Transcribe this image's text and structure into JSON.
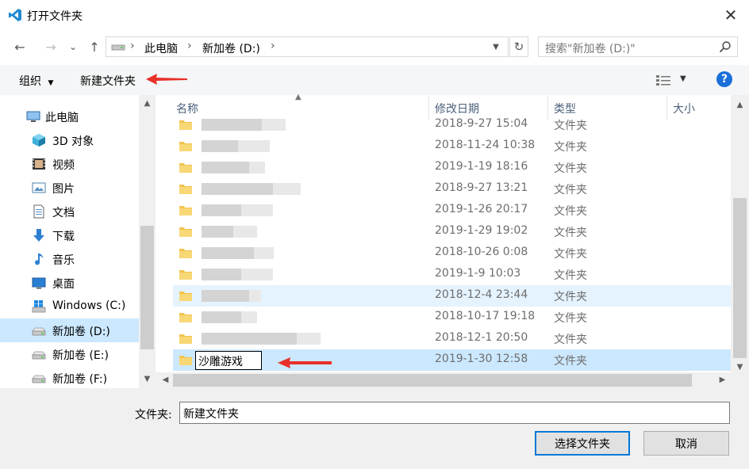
{
  "window": {
    "title": "打开文件夹",
    "close_glyph": "✕"
  },
  "nav": {
    "back_glyph": "←",
    "forward_glyph": "→",
    "recent_glyph": "⌄",
    "up_glyph": "↑",
    "breadcrumb": [
      "此电脑",
      "新加卷 (D:)"
    ],
    "refresh_glyph": "↻",
    "search_placeholder": "搜索\"新加卷 (D:)\""
  },
  "toolbar": {
    "organize": "组织",
    "new_folder": "新建文件夹",
    "help": "?"
  },
  "sidebar": {
    "items": [
      {
        "label": "此电脑",
        "icon": "computer-icon"
      },
      {
        "label": "3D 对象",
        "icon": "3d-objects-icon"
      },
      {
        "label": "视频",
        "icon": "video-icon"
      },
      {
        "label": "图片",
        "icon": "picture-icon"
      },
      {
        "label": "文档",
        "icon": "document-icon"
      },
      {
        "label": "下载",
        "icon": "download-icon"
      },
      {
        "label": "音乐",
        "icon": "music-icon"
      },
      {
        "label": "桌面",
        "icon": "desktop-icon"
      },
      {
        "label": "Windows (C:)",
        "icon": "windows-drive-icon"
      },
      {
        "label": "新加卷 (D:)",
        "icon": "drive-icon",
        "selected": true
      },
      {
        "label": "新加卷 (E:)",
        "icon": "drive-icon"
      },
      {
        "label": "新加卷 (F:)",
        "icon": "drive-icon"
      }
    ]
  },
  "file_list": {
    "columns": {
      "name": "名称",
      "modified": "修改日期",
      "type": "类型",
      "size": "大小"
    },
    "rows": [
      {
        "date": "2018-9-27 15:04",
        "type": "文件夹"
      },
      {
        "date": "2018-11-24 10:38",
        "type": "文件夹"
      },
      {
        "date": "2019-1-19 18:16",
        "type": "文件夹"
      },
      {
        "date": "2018-9-27 13:21",
        "type": "文件夹"
      },
      {
        "date": "2019-1-26 20:17",
        "type": "文件夹"
      },
      {
        "date": "2019-1-29 19:02",
        "type": "文件夹"
      },
      {
        "date": "2018-10-26 0:08",
        "type": "文件夹"
      },
      {
        "date": "2019-1-9 10:03",
        "type": "文件夹"
      },
      {
        "date": "2018-12-4 23:44",
        "type": "文件夹"
      },
      {
        "date": "2018-10-17 19:18",
        "type": "文件夹"
      },
      {
        "date": "2018-12-1 20:50",
        "type": "文件夹"
      },
      {
        "name": "沙雕游戏",
        "date": "2019-1-30 12:58",
        "type": "文件夹",
        "renaming": true
      }
    ]
  },
  "footer": {
    "folder_label": "文件夹:",
    "folder_value": "新建文件夹",
    "select_button": "选择文件夹",
    "cancel_button": "取消"
  },
  "colors": {
    "accent": "#0078d7",
    "selection": "#cce8ff",
    "hover": "#e5f3ff",
    "annotation": "#e8302a",
    "folder": "#f8d775"
  }
}
